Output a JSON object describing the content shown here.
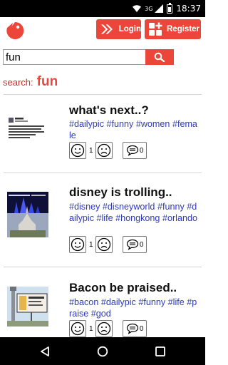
{
  "status_bar": {
    "network": "3G",
    "time": "18:37"
  },
  "header": {
    "login_label": "Login",
    "register_label": "Register"
  },
  "search": {
    "value": "fun",
    "label": "search:",
    "term": "fun"
  },
  "posts": [
    {
      "title": "what's next..?",
      "tags": [
        "#dailypic",
        "#funny",
        "#women",
        "#female"
      ],
      "up_count": "1",
      "comment_count": "0",
      "thumb_text": "Ask a female to become president; what's next? Female doctors? Female lawyers? Female engineers? Female women?"
    },
    {
      "title": "disney is trolling..",
      "tags": [
        "#disney",
        "#disneyworld",
        "#funny",
        "#dailypic",
        "#life",
        "#hongkong",
        "#orlando"
      ],
      "up_count": "1",
      "comment_count": "0"
    },
    {
      "title": "Bacon be praised..",
      "tags": [
        "#bacon",
        "#dailypic",
        "#funny",
        "#life",
        "#praise",
        "#god"
      ],
      "up_count": "1",
      "comment_count": "0"
    }
  ],
  "colors": {
    "accent": "#ec463b",
    "tag": "#2f39c6"
  },
  "icons": [
    "logo-icon",
    "login-arrow-icon",
    "register-icon",
    "search-icon",
    "smile-icon",
    "frown-icon",
    "comment-icon",
    "back-icon",
    "home-icon",
    "recents-icon"
  ]
}
